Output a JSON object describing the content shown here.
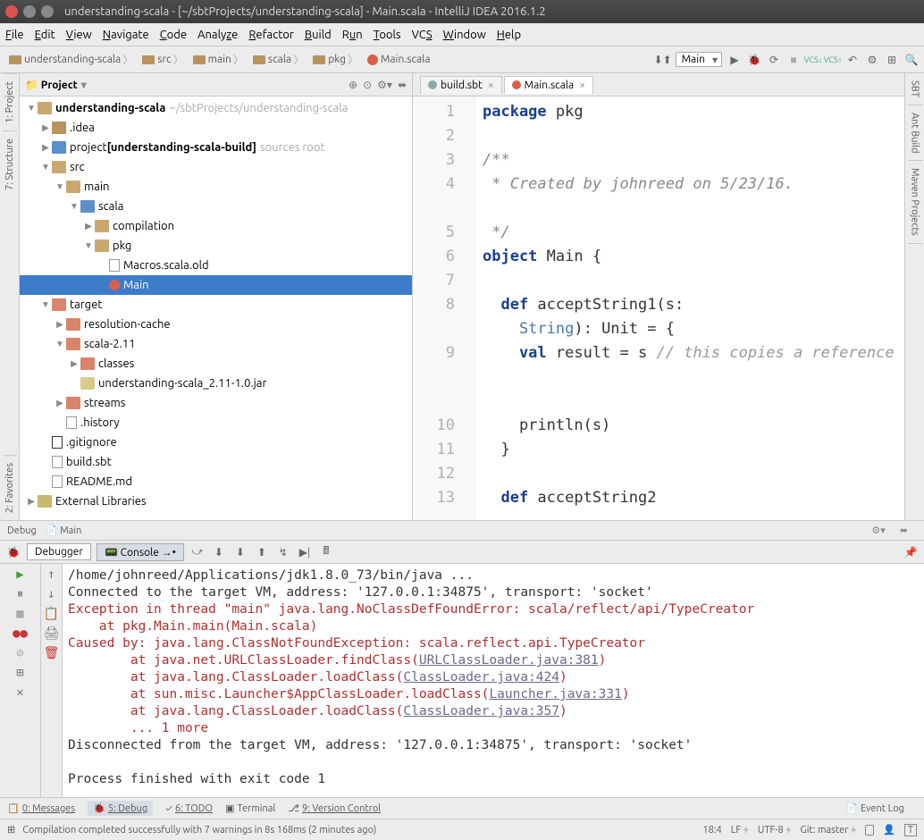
{
  "window": {
    "title": "understanding-scala - [~/sbtProjects/understanding-scala] - Main.scala - IntelliJ IDEA 2016.1.2"
  },
  "menu": {
    "file": "File",
    "edit": "Edit",
    "view": "View",
    "navigate": "Navigate",
    "code": "Code",
    "analyze": "Analyze",
    "refactor": "Refactor",
    "build": "Build",
    "run": "Run",
    "tools": "Tools",
    "vcs": "VCS",
    "window": "Window",
    "help": "Help"
  },
  "breadcrumb": {
    "root": "understanding-scala",
    "src": "src",
    "main": "main",
    "scala": "scala",
    "pkg": "pkg",
    "file": "Main.scala"
  },
  "runConf": {
    "selected": "Main"
  },
  "sidebar": {
    "project": "1: Project",
    "structure": "7: Structure",
    "favorites": "2: Favorites",
    "sbt": "SBT",
    "antbuild": "Ant Build",
    "maven": "Maven Projects"
  },
  "projectHeader": "Project",
  "tree": {
    "root": "understanding-scala",
    "rootPath": "~/sbtProjects/understanding-scala",
    "idea": ".idea",
    "projectMod": "project",
    "projectModBold": "[understanding-scala-build]",
    "projectModGray": "sources root",
    "src": "src",
    "mainDir": "main",
    "scalaDir": "scala",
    "compilation": "compilation",
    "pkg": "pkg",
    "macrosOld": "Macros.scala.old",
    "mainObj": "Main",
    "target": "target",
    "resCache": "resolution-cache",
    "scala211": "scala-2.11",
    "classes": "classes",
    "jar": "understanding-scala_2.11-1.0.jar",
    "streams": "streams",
    "history": ".history",
    "gitignore": ".gitignore",
    "buildsbt": "build.sbt",
    "readme": "README.md",
    "extlib": "External Libraries"
  },
  "editorTabs": {
    "build": "build.sbt",
    "main": "Main.scala"
  },
  "code": {
    "lines": [
      "1",
      "2",
      "3",
      "4",
      "",
      "5",
      "6",
      "7",
      "8",
      "",
      "9",
      "",
      "",
      "10",
      "11",
      "12",
      "13"
    ],
    "l1_kw": "package",
    "l1_id": " pkg",
    "l3": "/**",
    "l4": " * Created by johnreed on 5/23/16.",
    "l5": " */",
    "l6_kw": "object",
    "l6_id": " Main {",
    "l8a": "  def",
    "l8b": " acceptString1(s:",
    "l8c": "    String",
    "l8d": "): Unit = {",
    "l9a": "    val",
    "l9b": " result = s ",
    "l9c": "// this copies a reference to an immutable String",
    "l10": "    println(s)",
    "l11": "  }",
    "l13a": "  def",
    "l13b": " acceptString2"
  },
  "debug": {
    "tabName": "Debug",
    "mainName": "Main",
    "debugger": "Debugger",
    "console": "Console",
    "out": {
      "l1": "/home/johnreed/Applications/jdk1.8.0_73/bin/java ...",
      "l2": "Connected to the target VM, address: '127.0.0.1:34875', transport: 'socket'",
      "l3": "Exception in thread \"main\" java.lang.NoClassDefFoundError: scala/reflect/api/TypeCreator",
      "l4": "    at pkg.Main.main(Main.scala)",
      "l5": "Caused by: java.lang.ClassNotFoundException: scala.reflect.api.TypeCreator",
      "l6a": "        at java.net.URLClassLoader.findClass(",
      "l6b": "URLClassLoader.java:381",
      "l6c": ")",
      "l7a": "        at java.lang.ClassLoader.loadClass(",
      "l7b": "ClassLoader.java:424",
      "l7c": ")",
      "l8a": "        at sun.misc.Launcher$AppClassLoader.loadClass(",
      "l8b": "Launcher.java:331",
      "l8c": ")",
      "l9a": "        at java.lang.ClassLoader.loadClass(",
      "l9b": "ClassLoader.java:357",
      "l9c": ")",
      "l10": "        ... 1 more",
      "l11": "Disconnected from the target VM, address: '127.0.0.1:34875', transport: 'socket'",
      "l12": "",
      "l13": "Process finished with exit code 1"
    }
  },
  "bottomBar": {
    "messages": "0: Messages",
    "debug": "5: Debug",
    "todo": "6: TODO",
    "terminal": "Terminal",
    "vcs": "9: Version Control",
    "eventlog": "Event Log"
  },
  "status": {
    "msg": "Compilation completed successfully with 7 warnings in 8s 168ms (2 minutes ago)",
    "pos": "18:4",
    "lf": "LF",
    "enc": "UTF-8",
    "git": "Git: master"
  }
}
